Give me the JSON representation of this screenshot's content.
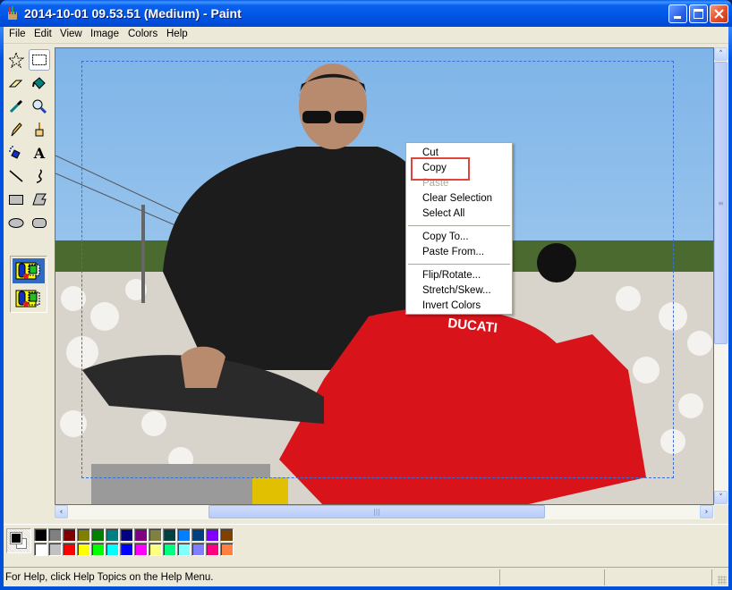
{
  "window": {
    "title": "2014-10-01 09.53.51 (Medium) - Paint",
    "controls": {
      "minimize": "minimize",
      "maximize": "maximize",
      "close": "close"
    }
  },
  "menubar": [
    "File",
    "Edit",
    "View",
    "Image",
    "Colors",
    "Help"
  ],
  "toolbox": {
    "tools": [
      {
        "name": "free-form-select",
        "icon": "star-select-icon"
      },
      {
        "name": "select",
        "icon": "rect-select-icon",
        "selected": true
      },
      {
        "name": "eraser",
        "icon": "eraser-icon"
      },
      {
        "name": "fill-with-color",
        "icon": "paint-bucket-icon"
      },
      {
        "name": "pick-color",
        "icon": "eyedropper-icon"
      },
      {
        "name": "magnifier",
        "icon": "magnifier-icon"
      },
      {
        "name": "pencil",
        "icon": "pencil-icon"
      },
      {
        "name": "brush",
        "icon": "brush-icon"
      },
      {
        "name": "airbrush",
        "icon": "airbrush-icon"
      },
      {
        "name": "text",
        "icon": "text-icon",
        "glyph": "A"
      },
      {
        "name": "line",
        "icon": "line-icon"
      },
      {
        "name": "curve",
        "icon": "curve-icon"
      },
      {
        "name": "rectangle",
        "icon": "rectangle-icon"
      },
      {
        "name": "polygon",
        "icon": "polygon-icon"
      },
      {
        "name": "ellipse",
        "icon": "ellipse-icon"
      },
      {
        "name": "rounded-rectangle",
        "icon": "rounded-rect-icon"
      }
    ],
    "options": [
      {
        "name": "opaque-selection",
        "selected": true
      },
      {
        "name": "transparent-selection",
        "selected": false
      }
    ]
  },
  "context_menu": {
    "items": [
      {
        "label": "Cut",
        "enabled": true
      },
      {
        "label": "Copy",
        "enabled": true,
        "highlighted": true
      },
      {
        "label": "Paste",
        "enabled": false
      },
      {
        "label": "Clear Selection",
        "enabled": true
      },
      {
        "label": "Select All",
        "enabled": true
      },
      {
        "separator": true
      },
      {
        "label": "Copy To...",
        "enabled": true
      },
      {
        "label": "Paste From...",
        "enabled": true
      },
      {
        "separator": true
      },
      {
        "label": "Flip/Rotate...",
        "enabled": true
      },
      {
        "label": "Stretch/Skew...",
        "enabled": true
      },
      {
        "label": "Invert Colors",
        "enabled": true
      }
    ],
    "highlight_color": "#e0443c"
  },
  "canvas": {
    "image_description": "Man in sunglasses and black jacket leaning on a red Ducati motorcycle in a cotton field under blue sky",
    "logo_text": "DUCATI",
    "selection": "dashed rectangle selection active"
  },
  "palette": {
    "foreground": "#000000",
    "background": "#ffffff",
    "colors": [
      [
        "#000000",
        "#808080",
        "#800000",
        "#808000",
        "#008000",
        "#008080",
        "#000080",
        "#800080",
        "#808040",
        "#004040",
        "#0080ff",
        "#004080",
        "#8000ff",
        "#804000"
      ],
      [
        "#ffffff",
        "#c0c0c0",
        "#ff0000",
        "#ffff00",
        "#00ff00",
        "#00ffff",
        "#0000ff",
        "#ff00ff",
        "#ffff80",
        "#00ff80",
        "#80ffff",
        "#8080ff",
        "#ff0080",
        "#ff8040"
      ]
    ]
  },
  "statusbar": {
    "help_text": "For Help, click Help Topics on the Help Menu."
  }
}
